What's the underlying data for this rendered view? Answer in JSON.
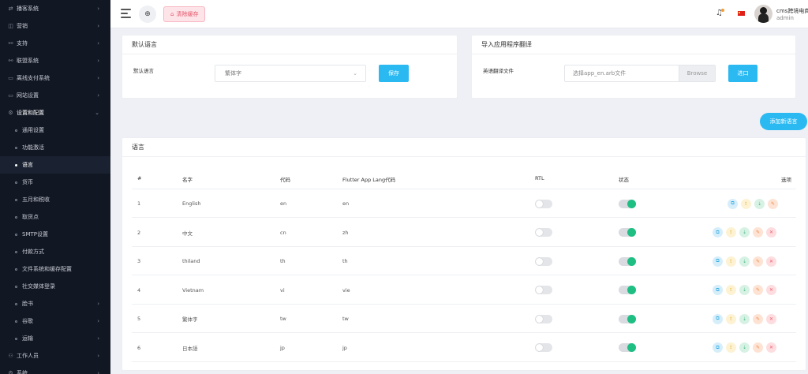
{
  "sidebar": {
    "items": [
      {
        "label": "播客系统",
        "icon": "podcast-icon",
        "glyph": "⇄",
        "chevron": true
      },
      {
        "label": "营销",
        "icon": "marketing-icon",
        "glyph": "◫",
        "chevron": true
      },
      {
        "label": "支持",
        "icon": "link-icon",
        "glyph": "⚯",
        "chevron": true
      },
      {
        "label": "联盟系统",
        "icon": "link-icon",
        "glyph": "⚯",
        "chevron": true
      },
      {
        "label": "离线支付系统",
        "icon": "wallet-icon",
        "glyph": "▭",
        "chevron": true
      },
      {
        "label": "网站设置",
        "icon": "monitor-icon",
        "glyph": "▭",
        "chevron": true
      },
      {
        "label": "设置和配置",
        "icon": "gear-icon",
        "glyph": "⚙",
        "chevron": true,
        "open": true
      }
    ],
    "subitems": [
      {
        "label": "通用设置"
      },
      {
        "label": "功能激活"
      },
      {
        "label": "语言",
        "active": true
      },
      {
        "label": "货币"
      },
      {
        "label": "五月和税收"
      },
      {
        "label": "取货点"
      },
      {
        "label": "SMTP设置"
      },
      {
        "label": "付款方式"
      },
      {
        "label": "文件系统和缓存配置"
      },
      {
        "label": "社交媒体登录"
      },
      {
        "label": "脸书",
        "chevron": true
      },
      {
        "label": "谷歌",
        "chevron": true
      },
      {
        "label": "运输",
        "chevron": true
      }
    ],
    "bottom": [
      {
        "label": "工作人员",
        "icon": "user-icon",
        "glyph": "⚇",
        "chevron": true
      },
      {
        "label": "系统",
        "icon": "settings-icon",
        "glyph": "⚙",
        "chevron": true
      }
    ]
  },
  "topbar": {
    "clear_cache": "清除缓存",
    "user_name": "cms跨境电商",
    "user_role": "admin"
  },
  "default_lang": {
    "title": "默认语言",
    "label": "默认语言",
    "selected": "繁体字",
    "save": "保存"
  },
  "import_lang": {
    "title": "导入应用程序翻译",
    "label": "英语翻译文件",
    "placeholder": "选择app_en.arb文件",
    "browse": "Browse",
    "import": "进口"
  },
  "add_language": "添加新语言",
  "languages": {
    "title": "语言",
    "headers": {
      "num": "#",
      "name": "名字",
      "code": "代码",
      "flutter": "Flutter App Lang代码",
      "rtl": "RTL",
      "status": "状态",
      "options": "选项"
    },
    "rows": [
      {
        "num": "1",
        "name": "English",
        "code": "en",
        "flutter": "en",
        "rtl": false,
        "status": true,
        "deletable": false
      },
      {
        "num": "2",
        "name": "中文",
        "code": "cn",
        "flutter": "zh",
        "rtl": false,
        "status": true,
        "deletable": true
      },
      {
        "num": "3",
        "name": "thiland",
        "code": "th",
        "flutter": "th",
        "rtl": false,
        "status": true,
        "deletable": true
      },
      {
        "num": "4",
        "name": "Vietnam",
        "code": "vi",
        "flutter": "vie",
        "rtl": false,
        "status": true,
        "deletable": true
      },
      {
        "num": "5",
        "name": "繁体字",
        "code": "tw",
        "flutter": "tw",
        "rtl": false,
        "status": true,
        "deletable": true
      },
      {
        "num": "6",
        "name": "日本語",
        "code": "jp",
        "flutter": "jp",
        "rtl": false,
        "status": true,
        "deletable": true
      }
    ]
  },
  "colors": {
    "accent": "#2bb9f2",
    "sidebar_bg": "#111723",
    "toggle_on": "#1fbf84",
    "danger": "#e4546a"
  }
}
